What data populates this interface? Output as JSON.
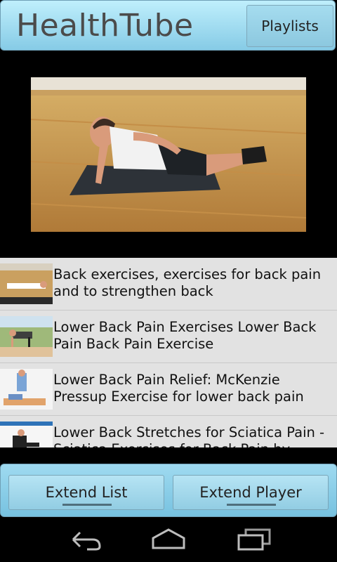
{
  "app": {
    "title": "HealthTube",
    "playlists_label": "Playlists"
  },
  "videos": [
    {
      "title": "Back exercises, exercises for back pain and to strengthen back"
    },
    {
      "title": "Lower Back Pain Exercises Lower Back Pain Back Pain Exercise"
    },
    {
      "title": "Lower Back Pain Relief: McKenzie Pressup Exercise for lower back pain"
    },
    {
      "title": "Lower Back Stretches for Sciatica Pain - Sciatica Exercises for Back Pain by"
    }
  ],
  "footer": {
    "extend_list": "Extend List",
    "extend_player": "Extend Player"
  },
  "navigation": {
    "icons": [
      "back-icon",
      "home-icon",
      "recent-apps-icon"
    ]
  },
  "colors": {
    "header_gradient_top": "#bfeffc",
    "header_gradient_bottom": "#86cbe6",
    "list_bg": "#e2e2e2"
  }
}
